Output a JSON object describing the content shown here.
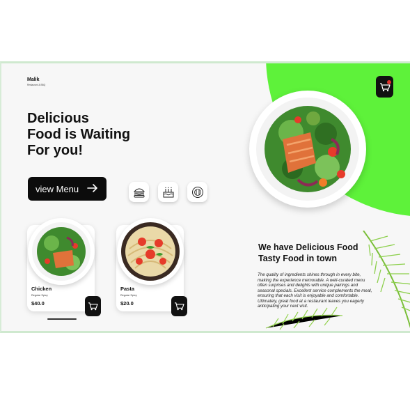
{
  "brand": {
    "name": "Malik",
    "subtitle": "Restaurant & BBQ"
  },
  "hero": {
    "headline_lines": [
      "Delicious",
      "Food is Waiting",
      "For you!"
    ],
    "cta_label": "view Menu"
  },
  "categories": [
    {
      "icon": "burger-icon"
    },
    {
      "icon": "cake-icon"
    },
    {
      "icon": "dinner-plate-icon"
    }
  ],
  "menu": {
    "items": [
      {
        "name": "Chicken",
        "tag": "Regular Spicy",
        "price": "$40.0"
      },
      {
        "name": "Pasta",
        "tag": "Regular Spicy",
        "price": "$20.0"
      }
    ]
  },
  "about": {
    "title_lines": [
      "We have Delicious Food",
      "Tasty Food in town"
    ],
    "text": "The quality of ingredients shines through in every bite, making the experience memorable. A well-curated menu often surprises and delights with unique pairings and seasonal specials. Excellent service complements the meal, ensuring that each visit is enjoyable and comfortable. Ultimately, great food at a restaurant leaves you eagerly anticipating your next visit."
  },
  "colors": {
    "accent": "#5ef23a",
    "dark": "#0c0c0c",
    "background": "#f7f7f7"
  },
  "icons": {
    "cart": "cart-icon",
    "arrow": "arrow-right-icon"
  }
}
